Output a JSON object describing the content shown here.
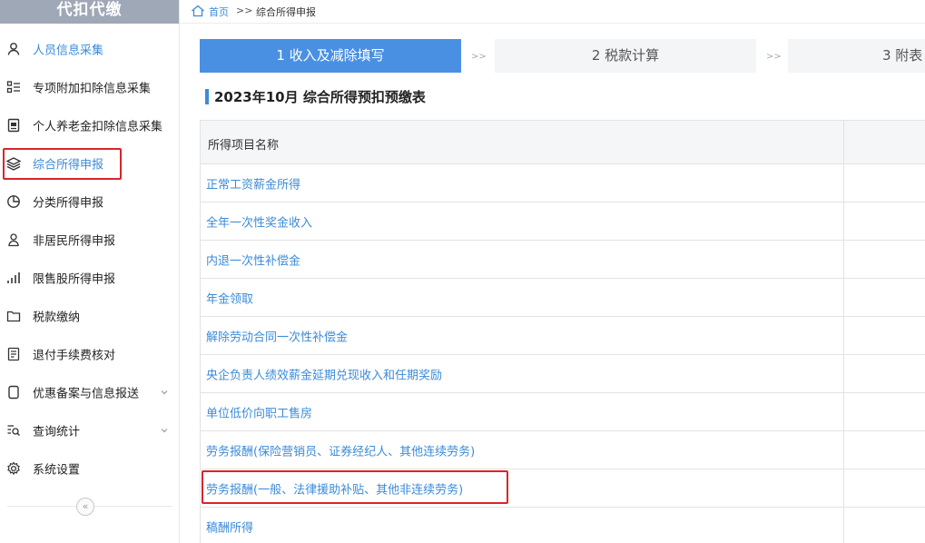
{
  "sidebar": {
    "header": "代扣代缴",
    "items": [
      {
        "label": "人员信息采集",
        "icon": "person-icon"
      },
      {
        "label": "专项附加扣除信息采集",
        "icon": "list-icon"
      },
      {
        "label": "个人养老金扣除信息采集",
        "icon": "document-icon"
      },
      {
        "label": "综合所得申报",
        "icon": "layers-icon"
      },
      {
        "label": "分类所得申报",
        "icon": "pie-chart-icon"
      },
      {
        "label": "非居民所得申报",
        "icon": "user-outline-icon"
      },
      {
        "label": "限售股所得申报",
        "icon": "bar-chart-icon"
      },
      {
        "label": "税款缴纳",
        "icon": "folder-icon"
      },
      {
        "label": "退付手续费核对",
        "icon": "receipt-icon"
      },
      {
        "label": "优惠备案与信息报送",
        "icon": "file-icon"
      },
      {
        "label": "查询统计",
        "icon": "search-list-icon"
      },
      {
        "label": "系统设置",
        "icon": "gear-icon"
      }
    ],
    "collapse_symbol": "«"
  },
  "breadcrumb": {
    "home": "首页",
    "separator": ">>",
    "current": "综合所得申报"
  },
  "steps": [
    {
      "label": "1 收入及减除填写"
    },
    {
      "label": "2 税款计算"
    },
    {
      "label": "3 附表"
    }
  ],
  "step_arrow": ">>",
  "page_title": "2023年10月  综合所得预扣预缴表",
  "table": {
    "header": "所得项目名称",
    "rows": [
      "正常工资薪金所得",
      "全年一次性奖金收入",
      "内退一次性补偿金",
      "年金领取",
      "解除劳动合同一次性补偿金",
      "央企负责人绩效薪金延期兑现收入和任期奖励",
      "单位低价向职工售房",
      "劳务报酬(保险营销员、证券经纪人、其他连续劳务)",
      "劳务报酬(一般、法律援助补贴、其他非连续劳务)",
      "稿酬所得"
    ]
  },
  "colors": {
    "accent": "#4a90e2",
    "link": "#3b8bd9",
    "highlight": "#d8252b",
    "sidebar_header": "#9ea8b6"
  }
}
